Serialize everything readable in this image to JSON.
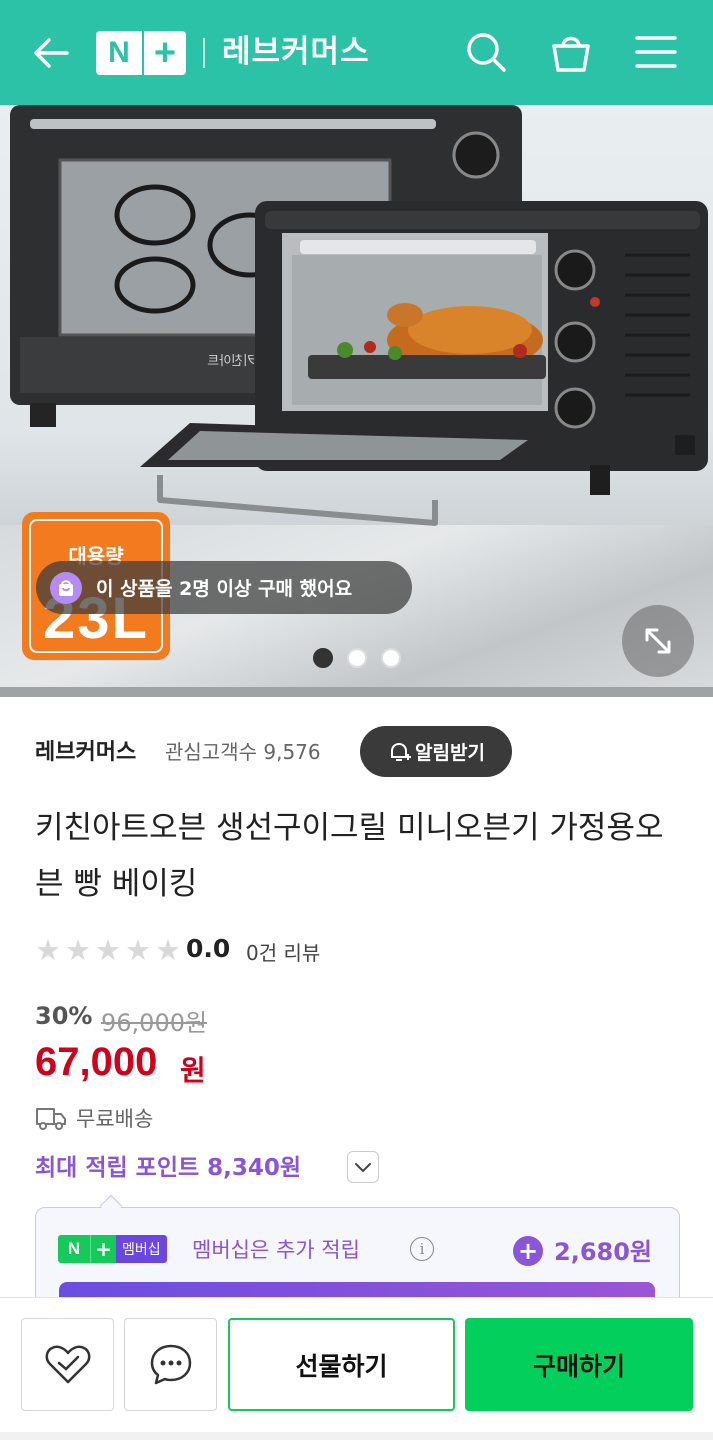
{
  "header": {
    "logo_n": "N",
    "logo_plus": "+",
    "store_title": "레브커머스",
    "bg_color": "#2cc2a7"
  },
  "hero": {
    "capacity_label": "대용량",
    "capacity_value": "23L",
    "buyers_notice": "이 상품을 2명 이상 구매 했어요",
    "oven_brand_print": "키친아트",
    "carousel": {
      "total": 3,
      "active": 1
    }
  },
  "store": {
    "name": "레브커머스",
    "fans": "관심고객수 9,576",
    "alarm_label": "알림받기"
  },
  "product": {
    "title": "키친아트오븐 생선구이그릴 미니오븐기 가정용오븐 빵 베이킹",
    "rating_score": "0.0",
    "rating_stars": 0,
    "review_count": "0건 리뷰"
  },
  "price": {
    "discount": "30%",
    "original": "96,000원",
    "sale": "67,000",
    "sale_unit": "원",
    "shipping": "무료배송",
    "points": "최대 적립 포인트 8,340원",
    "sale_color": "#d0021b"
  },
  "membership": {
    "badge_n": "N",
    "badge_plus": "+",
    "badge_text": "멤버십",
    "text": "멤버십은 추가 적립",
    "info_icon": "i",
    "amount": "2,680원",
    "accent_color": "#8a55d6"
  },
  "bottom_bar": {
    "gift_label": "선물하기",
    "buy_label": "구매하기",
    "buy_color": "#03cf5d"
  }
}
